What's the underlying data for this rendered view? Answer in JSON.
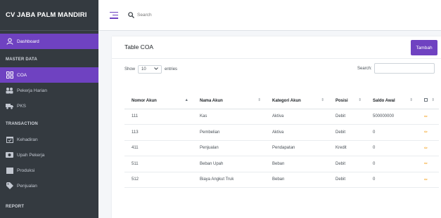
{
  "brand": "CV JABA PALM MANDIRI",
  "colors": {
    "sidebar": "#343a40",
    "accent": "#6f42c1",
    "edit": "#f39c12"
  },
  "sidebar": {
    "dashboard": {
      "label": "Dashboard",
      "icon": "user-icon"
    },
    "master_header": "MASTER DATA",
    "master_items": [
      {
        "label": "COA",
        "icon": "grid-icon"
      },
      {
        "label": "Pekerja Harian",
        "icon": "workers-icon"
      },
      {
        "label": "PKS",
        "icon": "truck-icon"
      }
    ],
    "transaction_header": "TRANSACTION",
    "transaction_items": [
      {
        "label": "Kehadiran",
        "icon": "calendar-check-icon"
      },
      {
        "label": "Upah Pekerja",
        "icon": "money-icon"
      },
      {
        "label": "Produksi",
        "icon": "box-icon"
      },
      {
        "label": "Penjualan",
        "icon": "tag-icon"
      }
    ],
    "report_header": "REPORT"
  },
  "topbar": {
    "search_placeholder": "Search"
  },
  "card": {
    "title": "Table COA",
    "add_button": "Tambah",
    "show_label": "Show",
    "entries_value": "10",
    "entries_label": "entries",
    "search_label": "Search:"
  },
  "table": {
    "columns": [
      "Nomor Akun",
      "Nama Akun",
      "Kategori Akun",
      "Posisi",
      "Saldo Awal",
      ""
    ],
    "rows": [
      [
        "111",
        "Kas",
        "Aktiva",
        "Debit",
        "500000000"
      ],
      [
        "113",
        "Pembelian",
        "Aktiva",
        "Debit",
        "0"
      ],
      [
        "411",
        "Penjualan",
        "Pendapatan",
        "Kredit",
        "0"
      ],
      [
        "511",
        "Beban Upah",
        "Beban",
        "Debit",
        "0"
      ],
      [
        "512",
        "Biaya Angkut Truk",
        "Beban",
        "Debit",
        "0"
      ]
    ]
  }
}
